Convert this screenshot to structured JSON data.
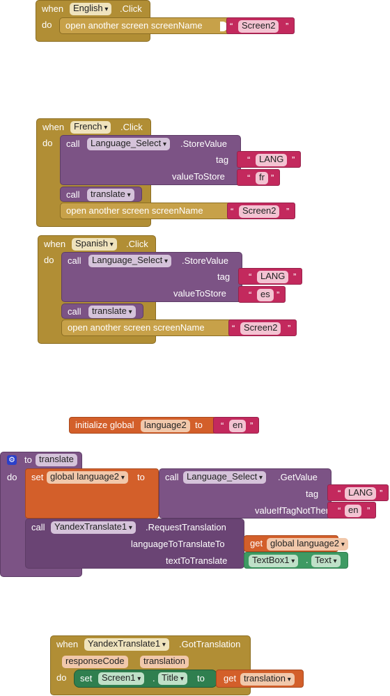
{
  "english_block": {
    "when": "when",
    "component": "English",
    "event": ".Click",
    "do": "do",
    "open_screen": "open another screen  screenName",
    "quote_open": "“",
    "screen_value": "Screen2",
    "quote_close": "”"
  },
  "french_block": {
    "when": "when",
    "component": "French",
    "event": ".Click",
    "do": "do",
    "call": "call",
    "store_component": "Language_Select",
    "store_method": ".StoreValue",
    "tag_label": "tag",
    "tag_value": "LANG",
    "value_label": "valueToStore",
    "value": "fr",
    "translate_call": "call",
    "translate_proc": "translate",
    "open_screen": "open another screen  screenName",
    "screen_value": "Screen2",
    "quote_open": "“",
    "quote_close": "”"
  },
  "spanish_block": {
    "when": "when",
    "component": "Spanish",
    "event": ".Click",
    "do": "do",
    "call": "call",
    "store_component": "Language_Select",
    "store_method": ".StoreValue",
    "tag_label": "tag",
    "tag_value": "LANG",
    "value_label": "valueToStore",
    "value": "es",
    "translate_call": "call",
    "translate_proc": "translate",
    "open_screen": "open another screen  screenName",
    "screen_value": "Screen2",
    "quote_open": "“",
    "quote_close": "”"
  },
  "global_init": {
    "prefix": "initialize global",
    "name": "language2",
    "to": "to",
    "quote_open": "“",
    "value": "en",
    "quote_close": "”"
  },
  "procedure": {
    "to": "to",
    "name": "translate",
    "do": "do",
    "set": "set",
    "set_var": "global language2",
    "set_to": "to",
    "call": "call",
    "get_component": "Language_Select",
    "get_method": ".GetValue",
    "tag_label": "tag",
    "tag_value": "LANG",
    "default_label": "valueIfTagNotThere",
    "default_value": "en",
    "call2": "call",
    "yandex_component": "YandexTranslate1",
    "yandex_method": ".RequestTranslation",
    "lang_label": "languageToTranslateTo",
    "get": "get",
    "get_var": "global language2",
    "text_label": "textToTranslate",
    "textbox": "TextBox1",
    "dot": ".",
    "text_prop": "Text",
    "quote_open": "“",
    "quote_close": "”"
  },
  "got_translation": {
    "when": "when",
    "component": "YandexTranslate1",
    "event": ".GotTranslation",
    "param1": "responseCode",
    "param2": "translation",
    "do": "do",
    "set": "set",
    "screen": "Screen1",
    "dot": ".",
    "prop": "Title",
    "to": "to",
    "get": "get",
    "get_var": "translation"
  },
  "icons": {
    "procedure_icon": "gear-icon"
  }
}
